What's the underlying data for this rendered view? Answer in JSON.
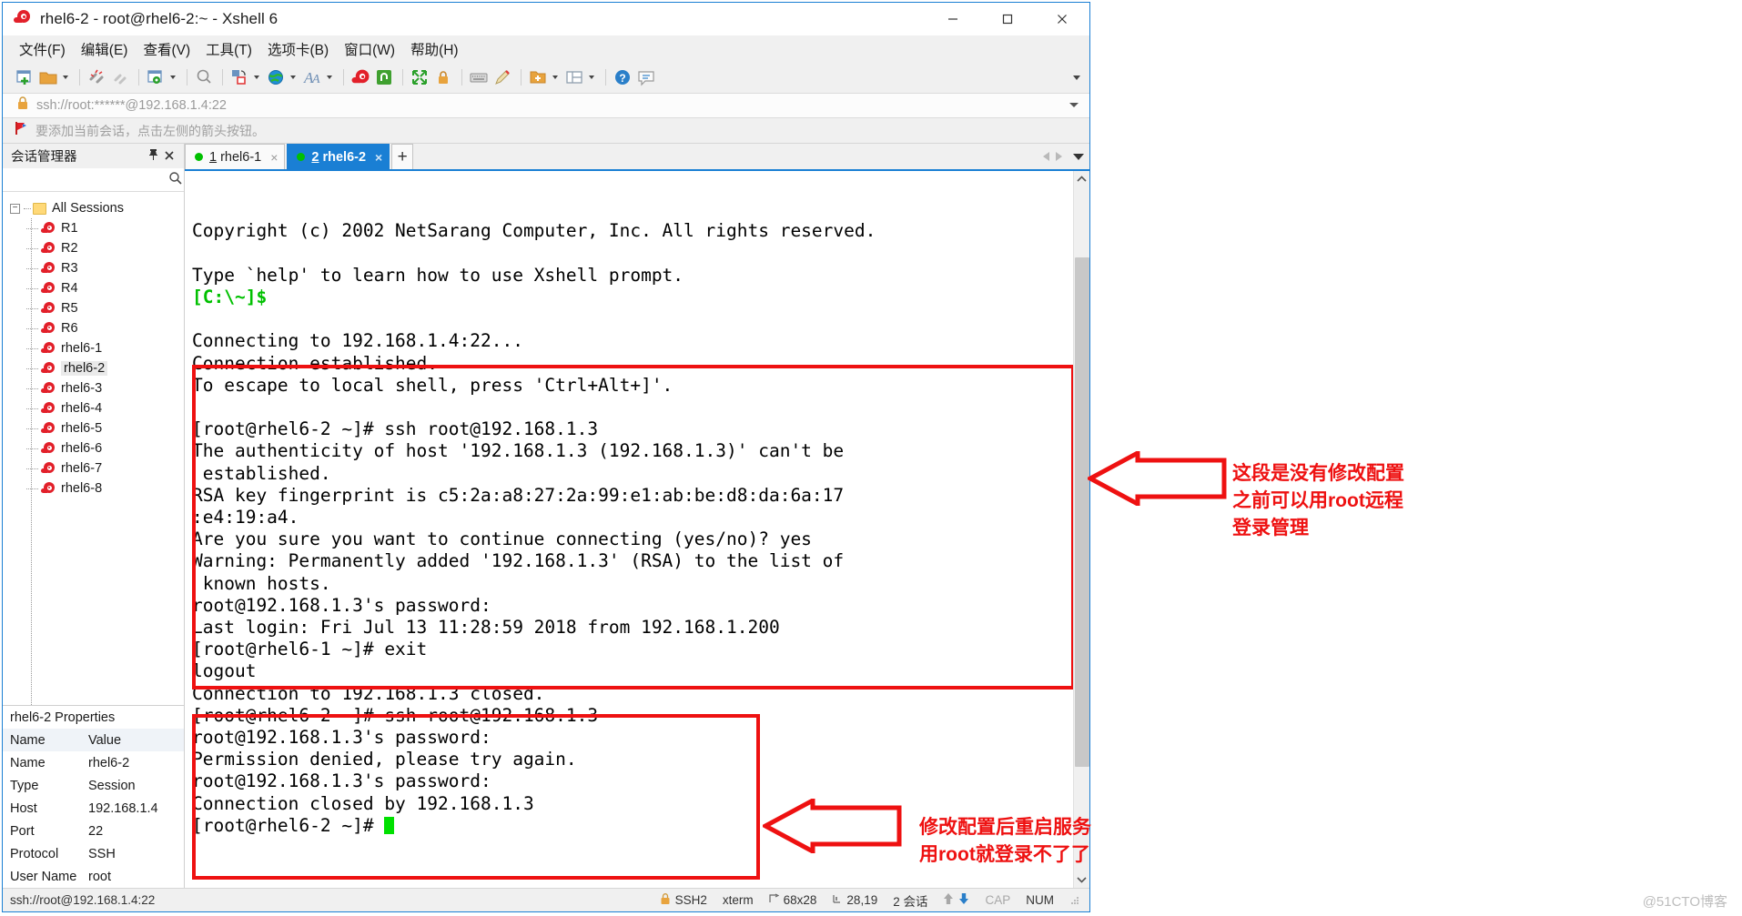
{
  "window": {
    "title": "rhel6-2 - root@rhel6-2:~ - Xshell 6",
    "app_icon": "xshell-snail-icon",
    "controls": {
      "minimize": "minimize-icon",
      "maximize": "maximize-icon",
      "close": "close-icon"
    }
  },
  "menubar": {
    "items": [
      {
        "label": "文件(F)",
        "name": "menu-file"
      },
      {
        "label": "编辑(E)",
        "name": "menu-edit"
      },
      {
        "label": "查看(V)",
        "name": "menu-view"
      },
      {
        "label": "工具(T)",
        "name": "menu-tools"
      },
      {
        "label": "选项卡(B)",
        "name": "menu-tabs"
      },
      {
        "label": "窗口(W)",
        "name": "menu-window"
      },
      {
        "label": "帮助(H)",
        "name": "menu-help"
      }
    ]
  },
  "urlbar": {
    "lock_icon": "lock-icon",
    "value": "ssh://root:******@192.168.1.4:22",
    "dropdown_icon": "chevron-down-icon"
  },
  "hintbar": {
    "flag_icon": "flag-icon",
    "text": "要添加当前会话，点击左侧的箭头按钮。"
  },
  "sidebar": {
    "title": "会话管理器",
    "pin_icon": "pin-icon",
    "close_icon": "close-icon",
    "search_placeholder": "",
    "search_value": "",
    "root_label": "All Sessions",
    "sessions": [
      "R1",
      "R2",
      "R3",
      "R4",
      "R5",
      "R6",
      "rhel6-1",
      "rhel6-2",
      "rhel6-3",
      "rhel6-4",
      "rhel6-5",
      "rhel6-6",
      "rhel6-7",
      "rhel6-8"
    ],
    "selected_session": "rhel6-2"
  },
  "properties": {
    "title": "rhel6-2 Properties",
    "headers": [
      "Name",
      "Value"
    ],
    "rows": [
      {
        "name": "Name",
        "value": "rhel6-2"
      },
      {
        "name": "Type",
        "value": "Session"
      },
      {
        "name": "Host",
        "value": "192.168.1.4"
      },
      {
        "name": "Port",
        "value": "22"
      },
      {
        "name": "Protocol",
        "value": "SSH"
      },
      {
        "name": "User Name",
        "value": "root"
      }
    ]
  },
  "tabs": {
    "items": [
      {
        "num": "1",
        "label": "rhel6-1",
        "active": false
      },
      {
        "num": "2",
        "label": "rhel6-2",
        "active": true
      }
    ],
    "add_label": "+",
    "close_glyph": "×"
  },
  "terminal": {
    "header_lines": [
      "Copyright (c) 2002 NetSarang Computer, Inc. All rights reserved.",
      "",
      "Type `help' to learn how to use Xshell prompt."
    ],
    "local_prompt": "[C:\\~]$",
    "connect_lines": [
      "",
      "Connecting to 192.168.1.4:22...",
      "Connection established.",
      "To escape to local shell, press 'Ctrl+Alt+]'."
    ],
    "block1": [
      "[root@rhel6-2 ~]# ssh root@192.168.1.3",
      "The authenticity of host '192.168.1.3 (192.168.1.3)' can't be",
      " established.",
      "RSA key fingerprint is c5:2a:a8:27:2a:99:e1:ab:be:d8:da:6a:17",
      ":e4:19:a4.",
      "Are you sure you want to continue connecting (yes/no)? yes",
      "Warning: Permanently added '192.168.1.3' (RSA) to the list of",
      " known hosts.",
      "root@192.168.1.3's password:",
      "Last login: Fri Jul 13 11:28:59 2018 from 192.168.1.200",
      "[root@rhel6-1 ~]# exit",
      "logout",
      "Connection to 192.168.1.3 closed."
    ],
    "block2": [
      "[root@rhel6-2 ~]# ssh root@192.168.1.3",
      "root@192.168.1.3's password:",
      "Permission denied, please try again.",
      "root@192.168.1.3's password:",
      "Connection closed by 192.168.1.3"
    ],
    "final_prompt": "[root@rhel6-2 ~]# "
  },
  "statusbar": {
    "connection": "ssh://root@192.168.1.4:22",
    "lock_icon": "lock-icon",
    "protocol": "SSH2",
    "terminal_type": "xterm",
    "size_icon": "resize-icon",
    "size": "68x28",
    "cursor_icon": "cursor-icon",
    "cursor": "28,19",
    "sessions": "2 会话",
    "upload_icon": "arrow-up-icon",
    "download_icon": "arrow-down-icon",
    "cap": "CAP",
    "num": "NUM"
  },
  "annotations": [
    {
      "name": "annotation-before-config",
      "lines": [
        "这段是没有修改配置",
        "之前可以用root远程",
        "登录管理"
      ],
      "arrow": "left-arrow-icon"
    },
    {
      "name": "annotation-after-config",
      "lines": [
        "修改配置后重启服务",
        "用root就登录不了了"
      ],
      "arrow": "left-arrow-icon"
    }
  ],
  "watermark": "@51CTO博客",
  "colors": {
    "accent": "#1a7fd4",
    "annotation_red": "#ee1111",
    "terminal_green": "#00c000",
    "window_bg": "#f0f0f0"
  }
}
